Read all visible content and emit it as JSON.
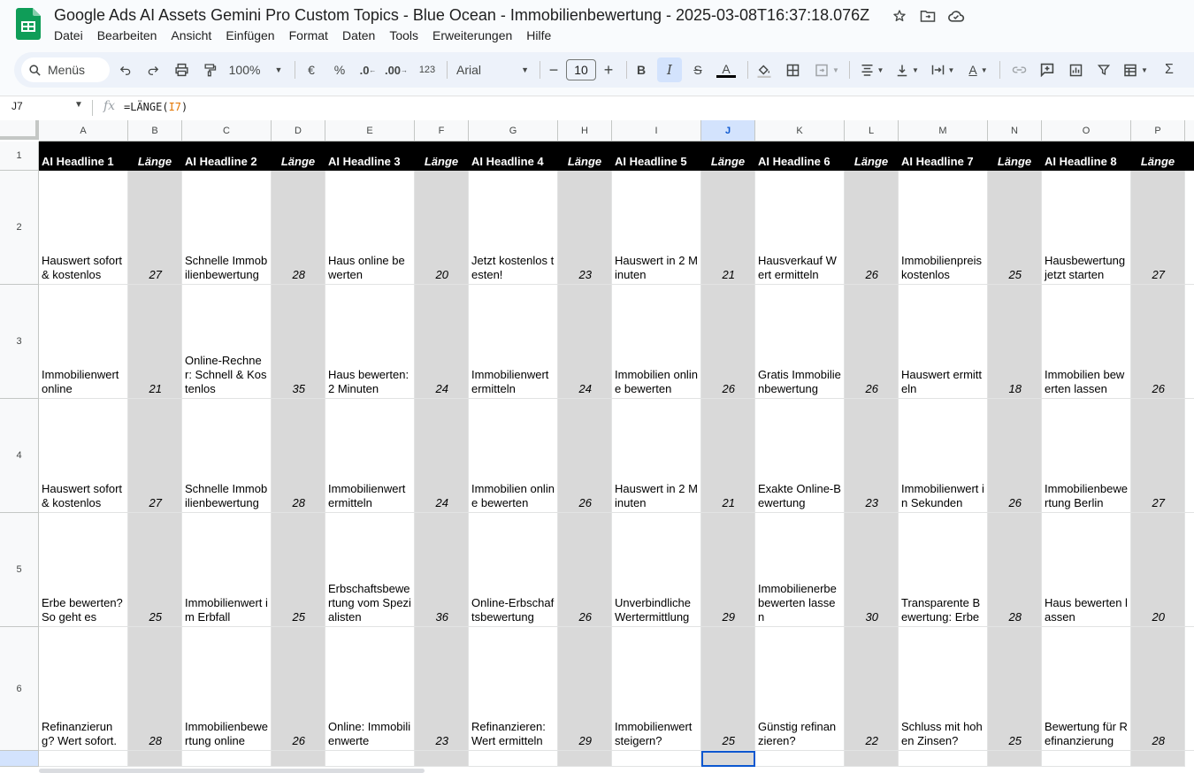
{
  "title": "Google Ads AI Assets Gemini Pro Custom Topics - Blue Ocean - Immobilienbewertung - 2025-03-08T16:37:18.076Z",
  "brand_color": "#0f9d58",
  "title_icons": [
    "star-icon",
    "move-to-folder-icon",
    "cloud-saved-icon"
  ],
  "menu": [
    "Datei",
    "Bearbeiten",
    "Ansicht",
    "Einfügen",
    "Format",
    "Daten",
    "Tools",
    "Erweiterungen",
    "Hilfe"
  ],
  "toolbar": {
    "search_label": "Menüs",
    "zoom": "100%",
    "currency": "€",
    "percent": "%",
    "dec_less": ".0",
    "dec_more": ".00",
    "number_format": "123",
    "font": "Arial",
    "font_size": "10",
    "bold": "B",
    "italic": "I",
    "text_color": "A",
    "sum": "Σ"
  },
  "formula_bar": {
    "cell_ref": "J7",
    "formula_prefix": "=LÄNGE(",
    "formula_ref": "I7",
    "formula_suffix": ")"
  },
  "columns": [
    "A",
    "B",
    "C",
    "D",
    "E",
    "F",
    "G",
    "H",
    "I",
    "J",
    "K",
    "L",
    "M",
    "N",
    "O",
    "P"
  ],
  "selected_column": "J",
  "rows": [
    "1",
    "2",
    "3",
    "4",
    "5",
    "6"
  ],
  "headers": [
    "AI Headline 1",
    "Länge",
    "AI Headline 2",
    "Länge",
    "AI Headline 3",
    "Länge",
    "AI Headline 4",
    "Länge",
    "AI Headline 5",
    "Länge",
    "AI Headline 6",
    "Länge",
    "AI Headline 7",
    "Länge",
    "AI Headline 8",
    "Länge"
  ],
  "data": [
    [
      "Hauswert sofort & kostenlos",
      "27",
      "Schnelle Immobilienbewertung",
      "28",
      "Haus online bewerten",
      "20",
      "Jetzt kostenlos testen!",
      "23",
      "Hauswert in 2 Minuten",
      "21",
      "Hausverkauf Wert ermitteln",
      "26",
      "Immobilienpreis kostenlos",
      "25",
      "Hausbewertung jetzt starten",
      "27"
    ],
    [
      "Immobilienwert online",
      "21",
      "Online-Rechner: Schnell & Kostenlos",
      "35",
      "Haus bewerten: 2 Minuten",
      "24",
      "Immobilienwert ermitteln",
      "24",
      "Immobilien online bewerten",
      "26",
      "Gratis Immobilienbewertung",
      "26",
      "Hauswert ermitteln",
      "18",
      "Immobilien bewerten lassen",
      "26"
    ],
    [
      "Hauswert sofort & kostenlos",
      "27",
      "Schnelle Immobilienbewertung",
      "28",
      "Immobilienwert ermitteln",
      "24",
      "Immobilien online bewerten",
      "26",
      "Hauswert in 2 Minuten",
      "21",
      "Exakte Online-Bewertung",
      "23",
      "Immobilienwert in Sekunden",
      "26",
      "Immobilienbewertung Berlin",
      "27"
    ],
    [
      "Erbe bewerten? So geht es",
      "25",
      "Immobilienwert im Erbfall",
      "25",
      "Erbschaftsbewertung vom Spezialisten",
      "36",
      "Online-Erbschaftsbewertung",
      "26",
      "Unverbindliche Wertermittlung",
      "29",
      "Immobilienerbe bewerten lassen",
      "30",
      "Transparente Bewertung: Erbe",
      "28",
      "Haus bewerten lassen",
      "20"
    ],
    [
      "Refinanzierung? Wert sofort.",
      "28",
      "Immobilienbewertung online",
      "26",
      "Online: Immobilienwerte",
      "23",
      "Refinanzieren: Wert ermitteln",
      "29",
      "Immobilienwert steigern?",
      "25",
      "Günstig refinanzieren?",
      "22",
      "Schluss mit hohen Zinsen?",
      "25",
      "Bewertung für Refinanzierung",
      "28"
    ]
  ]
}
